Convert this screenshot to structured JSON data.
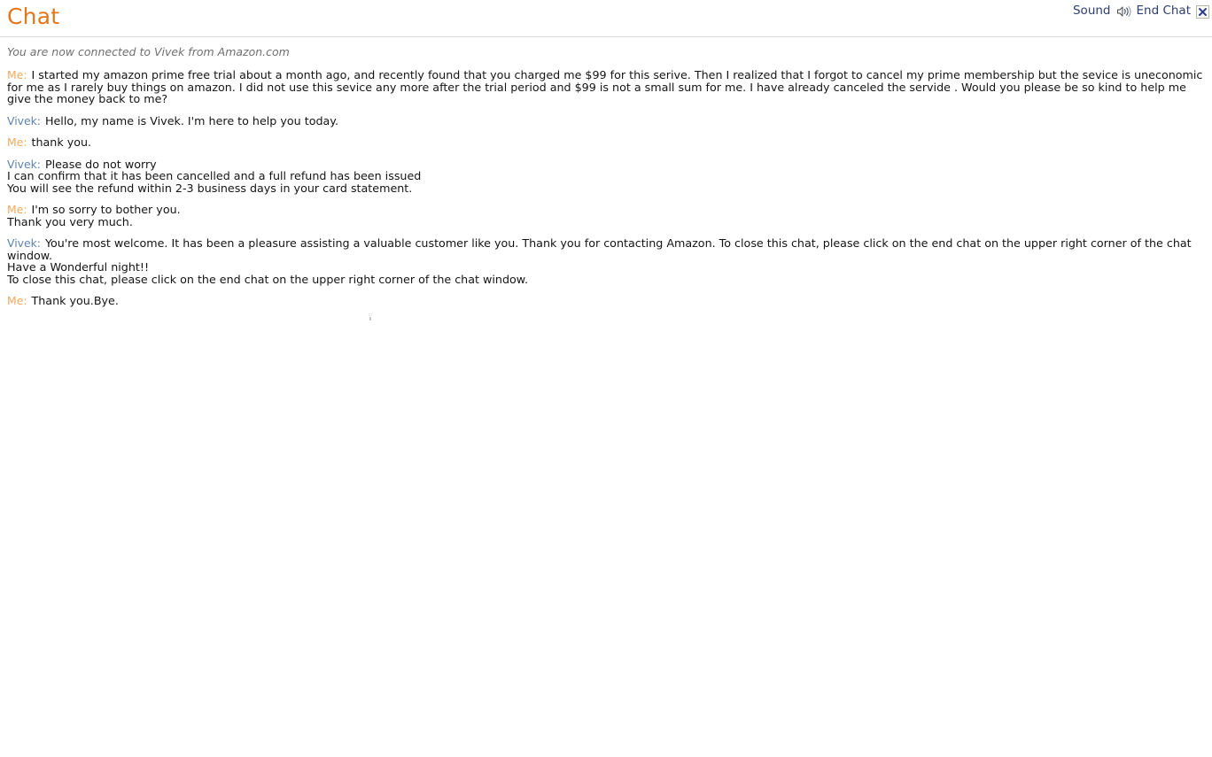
{
  "header": {
    "title": "Chat",
    "sound_label": "Sound",
    "sound_icon": "speaker-icon",
    "end_chat_label": "End Chat",
    "end_chat_icon": "close-x-icon",
    "title_color": "#e0781d",
    "control_text_color": "#2e3f6e"
  },
  "status": {
    "text": "You are now connected to Vivek from Amazon.com"
  },
  "colors": {
    "me_label": "#f0a95e",
    "agent_label": "#5d83ae",
    "body_text": "#141414",
    "status_text": "#6f6f6f",
    "divider": "#d9d9d9"
  },
  "messages": [
    {
      "speaker": "Me:",
      "role": "me",
      "lines": [
        "I started my amazon prime free trial about a month ago, and recently found that you charged me $99 for this serive. Then I realized that I forgot to cancel my prime membership but the sevice is uneconomic for me as I rarely buy things on amazon. I did not use this sevice any more after the trial period and $99 is not a small sum for me. I have already canceled the servide . Would you please be so kind to help me give the money back to me?"
      ]
    },
    {
      "speaker": "Vivek:",
      "role": "agent",
      "lines": [
        "Hello, my name is Vivek. I'm here to help you today."
      ]
    },
    {
      "speaker": "Me:",
      "role": "me",
      "lines": [
        "thank you."
      ]
    },
    {
      "speaker": "Vivek:",
      "role": "agent",
      "lines": [
        "Please do not worry",
        "I can confirm that it has been cancelled and a full refund has been issued",
        "You will see the refund within 2-3 business days in your card statement."
      ]
    },
    {
      "speaker": "Me:",
      "role": "me",
      "lines": [
        "I'm so sorry to bother you.",
        "Thank you very much."
      ]
    },
    {
      "speaker": "Vivek:",
      "role": "agent",
      "lines": [
        "You're most welcome. It has been a pleasure assisting a valuable customer like you. Thank you for contacting Amazon. To close this chat, please click on the end chat on the upper right corner of the chat window.",
        "Have a Wonderful night!!",
        "To close this chat, please click on the end chat on the upper right corner of the chat window."
      ]
    },
    {
      "speaker": "Me:",
      "role": "me",
      "lines": [
        "Thank you.Bye."
      ]
    }
  ]
}
